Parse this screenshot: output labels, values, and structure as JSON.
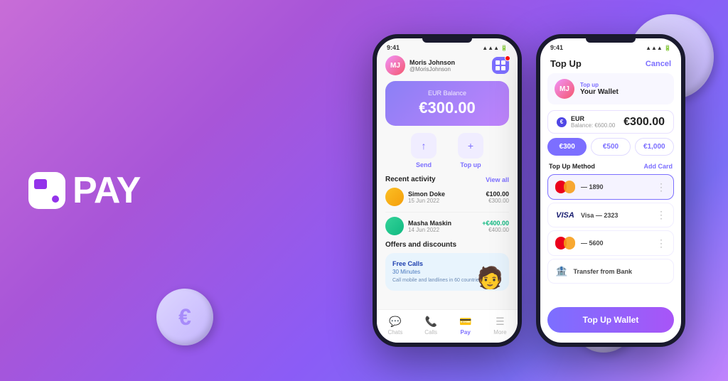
{
  "brand": {
    "name": "PAY",
    "tagline": "Pay"
  },
  "phone1": {
    "status_time": "9:41",
    "user": {
      "name": "Moris Johnson",
      "handle": "@MorisJohnson"
    },
    "balance": {
      "label": "EUR Balance",
      "amount": "€300.00"
    },
    "actions": [
      {
        "label": "Send",
        "icon": "↑"
      },
      {
        "label": "Top up",
        "icon": "+"
      }
    ],
    "recent_activity": {
      "title": "Recent activity",
      "view_all": "View all",
      "items": [
        {
          "name": "Simon Doke",
          "date": "15 Jun 2022",
          "amount": "€100.00",
          "balance": "€300.00",
          "positive": false
        },
        {
          "name": "Masha Maskin",
          "date": "14 Jun 2022",
          "amount": "+€400.00",
          "balance": "€400.00",
          "positive": true
        }
      ]
    },
    "offers": {
      "title": "Offers and discounts",
      "card": {
        "heading": "Free Calls",
        "sub": "30 Minutes",
        "desc": "Call mobile and landlines in 60 countries for free"
      }
    },
    "nav": [
      {
        "label": "Chats",
        "icon": "💬",
        "active": false
      },
      {
        "label": "Calls",
        "icon": "📞",
        "active": false
      },
      {
        "label": "Pay",
        "icon": "💳",
        "active": true
      },
      {
        "label": "More",
        "icon": "☰",
        "active": false
      }
    ]
  },
  "phone2": {
    "status_time": "9:41",
    "header": {
      "title": "Top Up",
      "cancel": "Cancel"
    },
    "wallet": {
      "tag": "Top up",
      "name": "Your Wallet"
    },
    "currency": {
      "code": "EUR",
      "balance_label": "Balance: €600.00",
      "amount": "€300.00"
    },
    "amount_chips": [
      {
        "label": "€300",
        "active": true
      },
      {
        "label": "€500",
        "active": false
      },
      {
        "label": "€1,000",
        "active": false
      }
    ],
    "method_section": {
      "title": "Top Up Method",
      "add_card": "Add Card"
    },
    "payment_methods": [
      {
        "type": "mastercard",
        "number": "— 1890",
        "selected": true
      },
      {
        "type": "visa",
        "number": "Visa — 2323",
        "selected": false
      },
      {
        "type": "mastercard2",
        "number": "— 5600",
        "selected": false
      },
      {
        "type": "bank",
        "number": "Transfer from Bank",
        "selected": false
      }
    ],
    "cta": "Top Up Wallet"
  }
}
